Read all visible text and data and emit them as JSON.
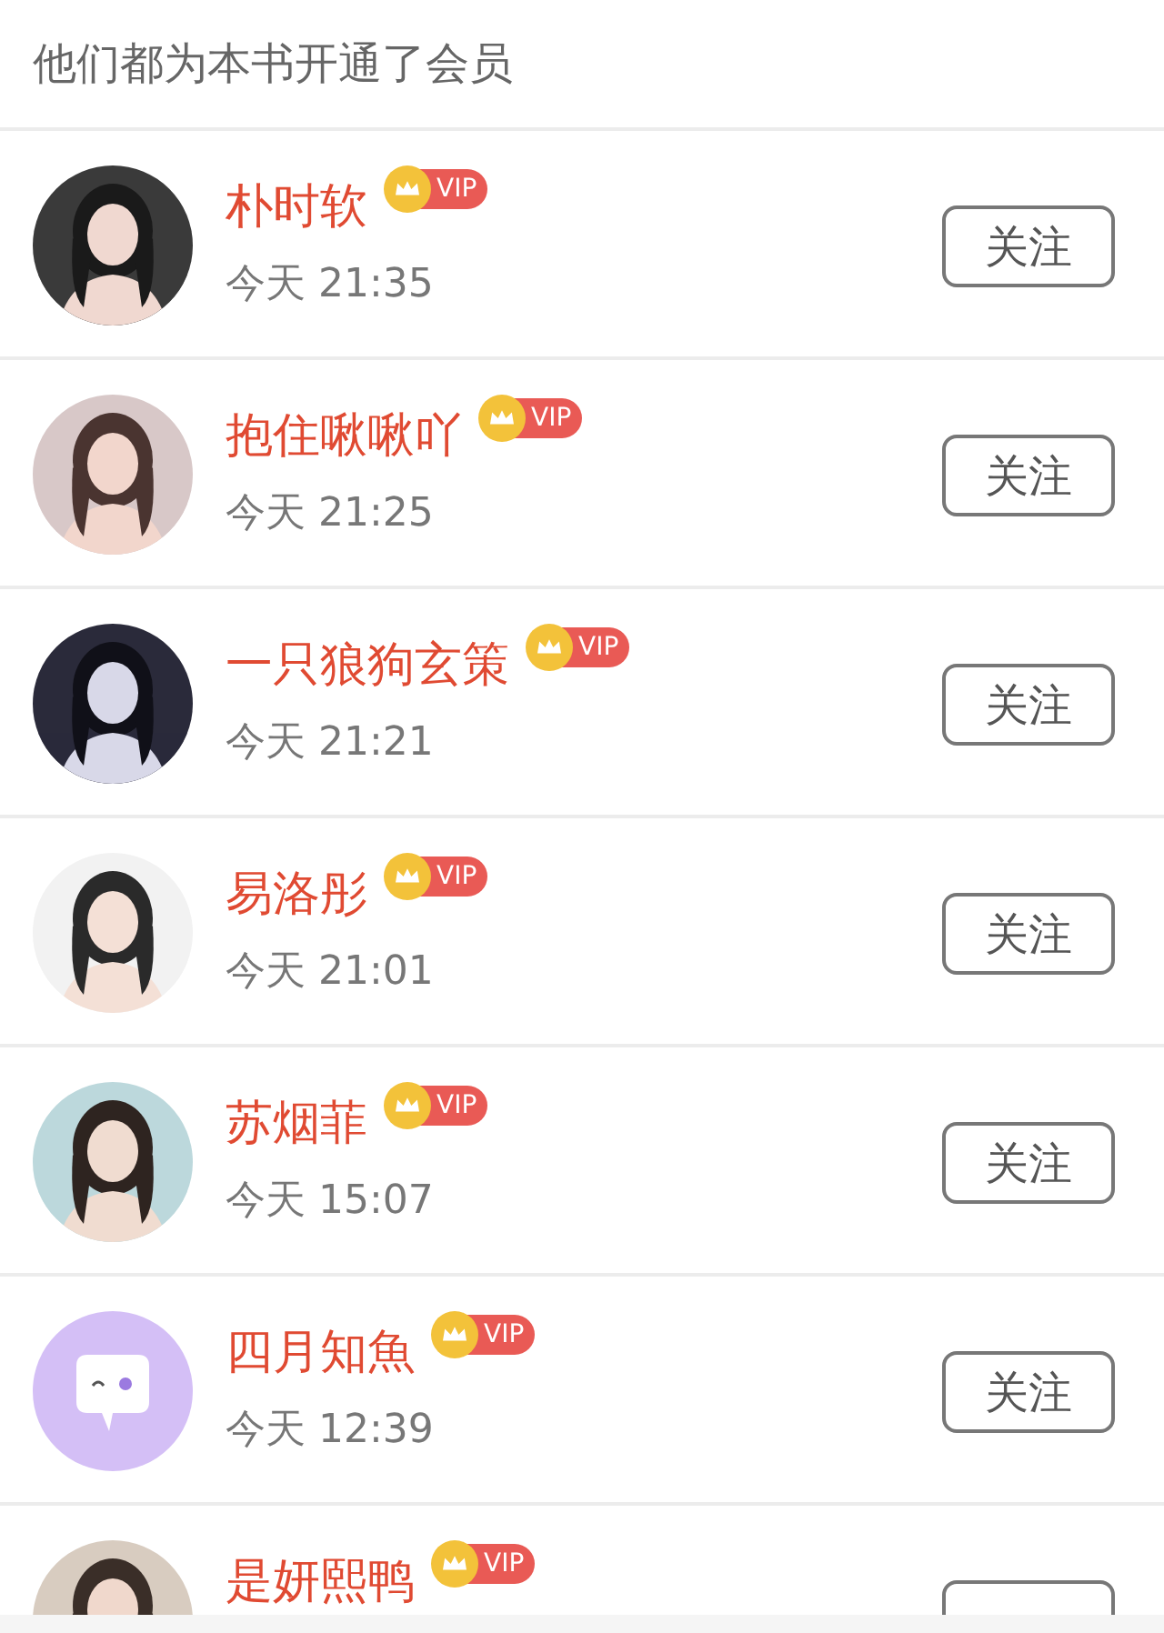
{
  "header": {
    "title": "他们都为本书开通了会员"
  },
  "members": [
    {
      "name": "朴时软",
      "vip": "VIP",
      "time": "今天 21:35",
      "follow": "关注"
    },
    {
      "name": "抱住啾啾吖",
      "vip": "VIP",
      "time": "今天 21:25",
      "follow": "关注"
    },
    {
      "name": "一只狼狗玄策",
      "vip": "VIP",
      "time": "今天 21:21",
      "follow": "关注"
    },
    {
      "name": "易洛彤",
      "vip": "VIP",
      "time": "今天 21:01",
      "follow": "关注"
    },
    {
      "name": "苏烟菲",
      "vip": "VIP",
      "time": "今天 15:07",
      "follow": "关注"
    },
    {
      "avatar": {
        "kind": "icon"
      },
      "name": "四月知魚",
      "vip": "VIP",
      "time": "今天 12:39",
      "follow": "关注"
    },
    {
      "name": "是妍熙鸭",
      "vip": "VIP"
    }
  ]
}
